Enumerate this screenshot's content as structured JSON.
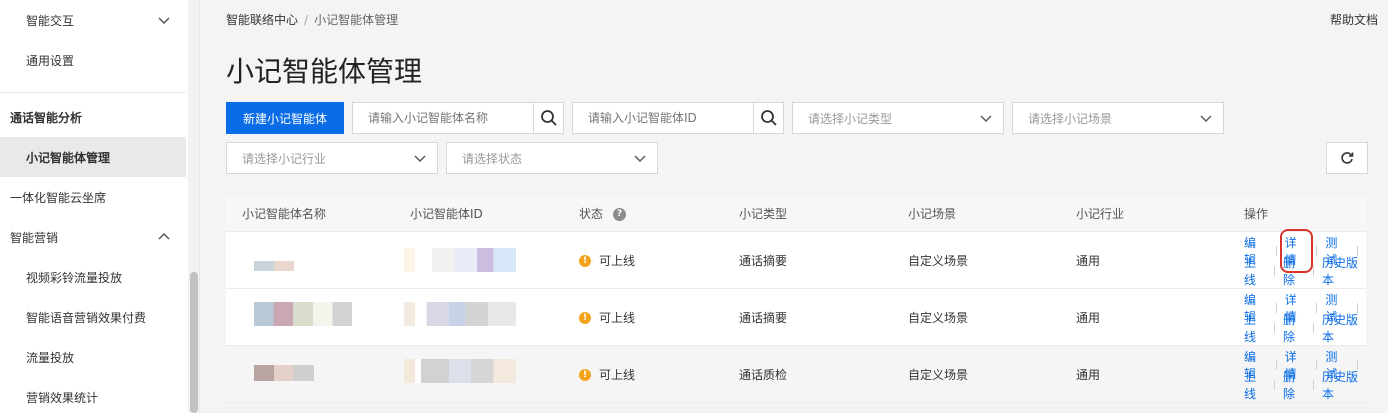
{
  "sidebar": {
    "items": [
      {
        "label": "智能交互"
      },
      {
        "label": "通用设置"
      },
      {
        "label": "通话智能分析"
      },
      {
        "label": "小记智能体管理"
      },
      {
        "label": "一体化智能云坐席"
      },
      {
        "label": "智能营销"
      },
      {
        "label": "视频彩铃流量投放"
      },
      {
        "label": "智能语音营销效果付费"
      },
      {
        "label": "流量投放"
      },
      {
        "label": "营销效果统计"
      }
    ]
  },
  "header": {
    "breadcrumb_root": "智能联络中心",
    "breadcrumb_sep": "/",
    "breadcrumb_current": "小记智能体管理",
    "help": "帮助文档",
    "title": "小记智能体管理"
  },
  "toolbar": {
    "create_label": "新建小记智能体",
    "name_search_placeholder": "请输入小记智能体名称",
    "id_search_placeholder": "请输入小记智能体ID",
    "type_select": "请选择小记类型",
    "scene_select": "请选择小记场景",
    "industry_select": "请选择小记行业",
    "status_select": "请选择状态"
  },
  "table": {
    "columns": [
      "小记智能体名称",
      "小记智能体ID",
      "状态",
      "小记类型",
      "小记场景",
      "小记行业",
      "操作"
    ],
    "rows": [
      {
        "status": "可上线",
        "type": "通话摘要",
        "scene": "自定义场景",
        "industry": "通用"
      },
      {
        "status": "可上线",
        "type": "通话摘要",
        "scene": "自定义场景",
        "industry": "通用"
      },
      {
        "status": "可上线",
        "type": "通话质检",
        "scene": "自定义场景",
        "industry": "通用"
      }
    ],
    "ops": {
      "edit": "编辑",
      "detail": "详情",
      "test": "测试",
      "online": "上线",
      "delete": "删除",
      "history": "历史版本"
    }
  },
  "colors": {
    "primary": "#0a6ce6",
    "warning": "#f4a41c",
    "highlight": "#d9342b"
  }
}
